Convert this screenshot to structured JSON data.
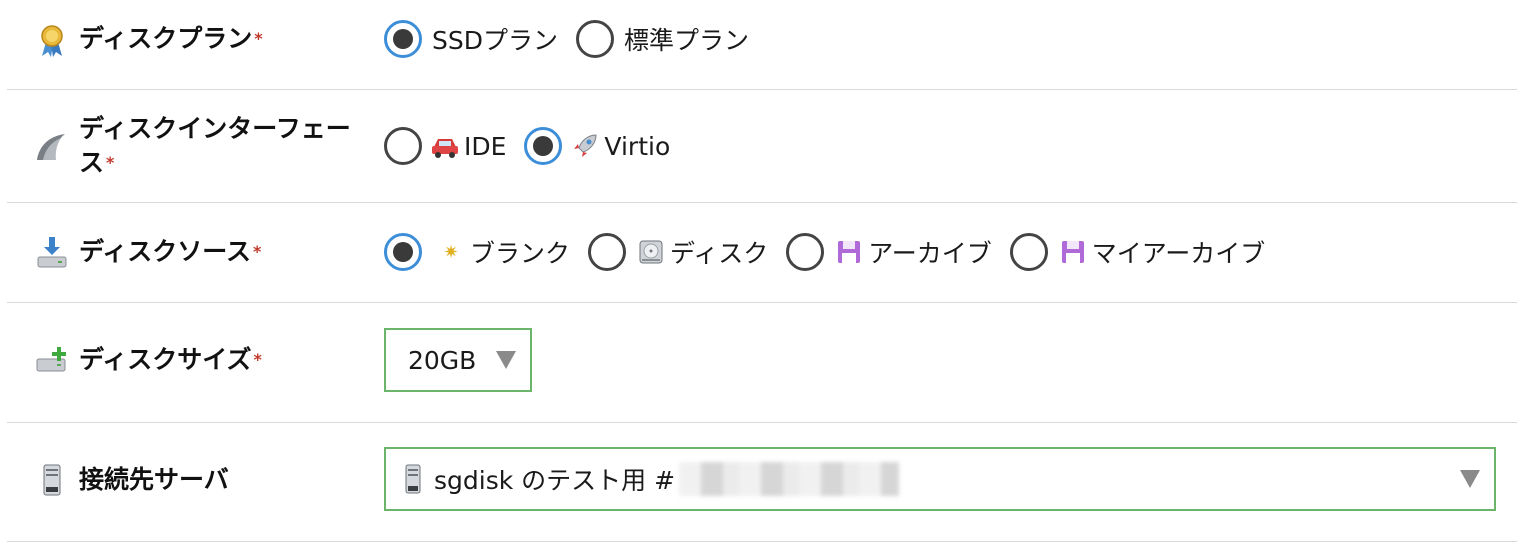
{
  "rows": {
    "disk_plan": {
      "label": "ディスクプラン",
      "required_mark": "*",
      "icon": "award-ribbon-icon",
      "options": [
        {
          "label": "SSDプラン",
          "selected": true
        },
        {
          "label": "標準プラン",
          "selected": false
        }
      ]
    },
    "disk_interface": {
      "label_line1": "ディスクインターフェー",
      "label_line2": "ス",
      "required_mark": "*",
      "icon": "wave-icon",
      "options": [
        {
          "label": "IDE",
          "icon": "car-icon",
          "selected": false
        },
        {
          "label": "Virtio",
          "icon": "rocket-icon",
          "selected": true
        }
      ]
    },
    "disk_source": {
      "label": "ディスクソース",
      "required_mark": "*",
      "icon": "download-disk-icon",
      "options": [
        {
          "label": "ブランク",
          "icon": "sparkle-icon",
          "selected": true
        },
        {
          "label": "ディスク",
          "icon": "hard-disk-icon",
          "selected": false
        },
        {
          "label": "アーカイブ",
          "icon": "floppy-icon",
          "selected": false
        },
        {
          "label": "マイアーカイブ",
          "icon": "floppy-icon",
          "selected": false
        }
      ]
    },
    "disk_size": {
      "label": "ディスクサイズ",
      "required_mark": "*",
      "icon": "add-disk-icon",
      "selected_value": "20GB"
    },
    "target_server": {
      "label": "接続先サーバ",
      "icon": "server-icon",
      "selected_value": "sgdisk のテスト用 #"
    }
  },
  "colors": {
    "radio_selected_ring": "#3d8ed8",
    "select_border": "#6ab56a",
    "required": "#c0392b"
  }
}
